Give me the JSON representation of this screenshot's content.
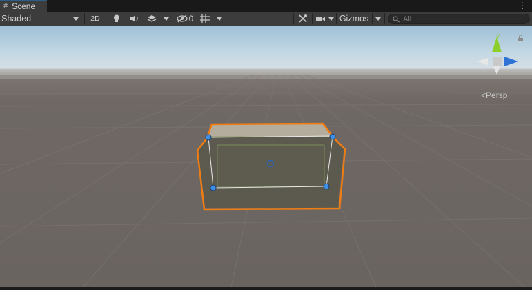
{
  "tab": {
    "title": "Scene"
  },
  "toolbar": {
    "draw_mode": "Shaded",
    "mode_2d": "2D",
    "hidden_count": "0",
    "gizmos": "Gizmos",
    "search_placeholder": "All"
  },
  "gizmo": {
    "axis_y": "y",
    "projection": "Persp"
  },
  "colors": {
    "selection_outline": "#f07d13",
    "handle": "#3d8ee6",
    "ground": "#6c6560",
    "sky": "#b9d3e2"
  }
}
